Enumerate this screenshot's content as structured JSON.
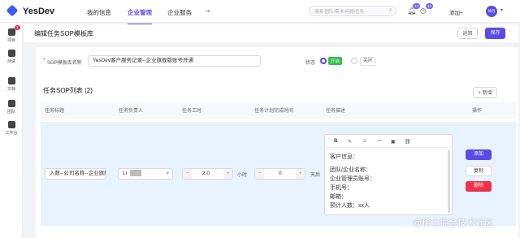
{
  "header": {
    "brand": "YesDev",
    "nav": [
      "我的信息",
      "企业管理",
      "企业服务"
    ],
    "search_placeholder": "搜索 团队/需求/问题/任务",
    "badge1": "13",
    "badge2": "42",
    "add_label": "添加+",
    "user": "徐丹"
  },
  "sidebar": {
    "items": [
      {
        "label": "项目",
        "badge": "1"
      },
      {
        "label": "测试"
      },
      {
        "label": "文档"
      },
      {
        "label": "团队"
      },
      {
        "label": "工作台"
      }
    ]
  },
  "page": {
    "title": "编辑任务SOP模板库",
    "return_label": "返回",
    "save_label": "保存"
  },
  "form": {
    "name_label": "SOP模板库名称",
    "name_value": "YesDev客户服务记录--企业旗舰版账号开通",
    "status_label": "状态",
    "status_on": "开启",
    "status_off": "关闭"
  },
  "list": {
    "title": "任务SOP列表 (2)",
    "add_label": "+ 新增",
    "columns": [
      "任务标题",
      "任务负责人",
      "任务工时",
      "任务计划完成时间",
      "任务描述",
      "操作"
    ]
  },
  "row": {
    "title": "入数--公司名称--企业旗舰",
    "owner": "Li",
    "hours": "2.0",
    "hours_unit": "小时",
    "days": "0",
    "days_unit": "天后",
    "editor_toolbar": [
      "B",
      "✎",
      "☺",
      "⌒",
      "▣",
      "⛓"
    ],
    "desc": [
      "客户信息：",
      "团队/企业名称：",
      "企业管理员账号：",
      "手机号：",
      "邮箱：",
      "预计人数：xx人"
    ],
    "actions": [
      "添加",
      "复制",
      "删除"
    ]
  },
  "watermark": "@稀土掘金技术社区",
  "colors": {
    "accent": "#5b4be6",
    "danger": "#f0304a",
    "success": "#2fbf4f"
  }
}
